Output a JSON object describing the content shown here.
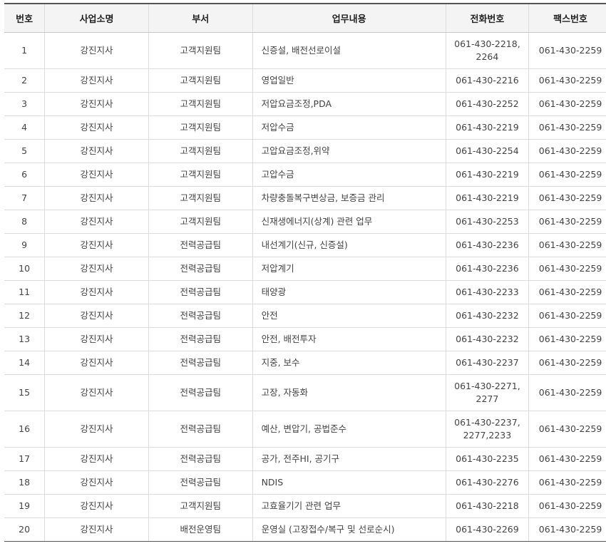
{
  "table": {
    "headers": {
      "no": "번호",
      "office": "사업소명",
      "dept": "부서",
      "task": "업무내용",
      "tel": "전화번호",
      "fax": "팩스번호"
    },
    "rows": [
      {
        "no": "1",
        "office": "강진지사",
        "dept": "고객지원팀",
        "task": "신증설, 배전선로이설",
        "tel": "061-430-2218, 2264",
        "fax": "061-430-2259"
      },
      {
        "no": "2",
        "office": "강진지사",
        "dept": "고객지원팀",
        "task": "영업일반",
        "tel": "061-430-2216",
        "fax": "061-430-2259"
      },
      {
        "no": "3",
        "office": "강진지사",
        "dept": "고객지원팀",
        "task": "저압요금조정,PDA",
        "tel": "061-430-2252",
        "fax": "061-430-2259"
      },
      {
        "no": "4",
        "office": "강진지사",
        "dept": "고객지원팀",
        "task": "저압수금",
        "tel": "061-430-2219",
        "fax": "061-430-2259"
      },
      {
        "no": "5",
        "office": "강진지사",
        "dept": "고객지원팀",
        "task": "고압요금조정,위약",
        "tel": "061-430-2254",
        "fax": "061-430-2259"
      },
      {
        "no": "6",
        "office": "강진지사",
        "dept": "고객지원팀",
        "task": "고압수금",
        "tel": "061-430-2219",
        "fax": "061-430-2259"
      },
      {
        "no": "7",
        "office": "강진지사",
        "dept": "고객지원팀",
        "task": "차량충돌복구변상금, 보증금 관리",
        "tel": "061-430-2219",
        "fax": "061-430-2259"
      },
      {
        "no": "8",
        "office": "강진지사",
        "dept": "고객지원팀",
        "task": "신재생에너지(상계) 관련 업무",
        "tel": "061-430-2253",
        "fax": "061-430-2259"
      },
      {
        "no": "9",
        "office": "강진지사",
        "dept": "전력공급팀",
        "task": "내선계기(신규, 신증설)",
        "tel": "061-430-2236",
        "fax": "061-430-2259"
      },
      {
        "no": "10",
        "office": "강진지사",
        "dept": "전력공급팀",
        "task": "저압계기",
        "tel": "061-430-2236",
        "fax": "061-430-2259"
      },
      {
        "no": "11",
        "office": "강진지사",
        "dept": "전력공급팀",
        "task": "태양광",
        "tel": "061-430-2233",
        "fax": "061-430-2259"
      },
      {
        "no": "12",
        "office": "강진지사",
        "dept": "전력공급팀",
        "task": "안전",
        "tel": "061-430-2232",
        "fax": "061-430-2259"
      },
      {
        "no": "13",
        "office": "강진지사",
        "dept": "전력공급팀",
        "task": "안전, 배전투자",
        "tel": "061-430-2232",
        "fax": "061-430-2259"
      },
      {
        "no": "14",
        "office": "강진지사",
        "dept": "전력공급팀",
        "task": "지중, 보수",
        "tel": "061-430-2237",
        "fax": "061-430-2259"
      },
      {
        "no": "15",
        "office": "강진지사",
        "dept": "전력공급팀",
        "task": "고장, 자동화",
        "tel": "061-430-2271, 2277",
        "fax": "061-430-2259"
      },
      {
        "no": "16",
        "office": "강진지사",
        "dept": "전력공급팀",
        "task": "예산, 변압기, 공법준수",
        "tel": "061-430-2237, 2277,2233",
        "fax": "061-430-2259"
      },
      {
        "no": "17",
        "office": "강진지사",
        "dept": "전력공급팀",
        "task": "공가, 전주HI, 공기구",
        "tel": "061-430-2235",
        "fax": "061-430-2259"
      },
      {
        "no": "18",
        "office": "강진지사",
        "dept": "전력공급팀",
        "task": "NDIS",
        "tel": "061-430-2276",
        "fax": "061-430-2259"
      },
      {
        "no": "19",
        "office": "강진지사",
        "dept": "고객지원팀",
        "task": "고효율기기 관련 업무",
        "tel": "061-430-2218",
        "fax": "061-430-2259"
      },
      {
        "no": "20",
        "office": "강진지사",
        "dept": "배전운영팀",
        "task": "운영실 (고장접수/복구 및 선로순시)",
        "tel": "061-430-2269",
        "fax": "061-430-2259"
      }
    ]
  }
}
